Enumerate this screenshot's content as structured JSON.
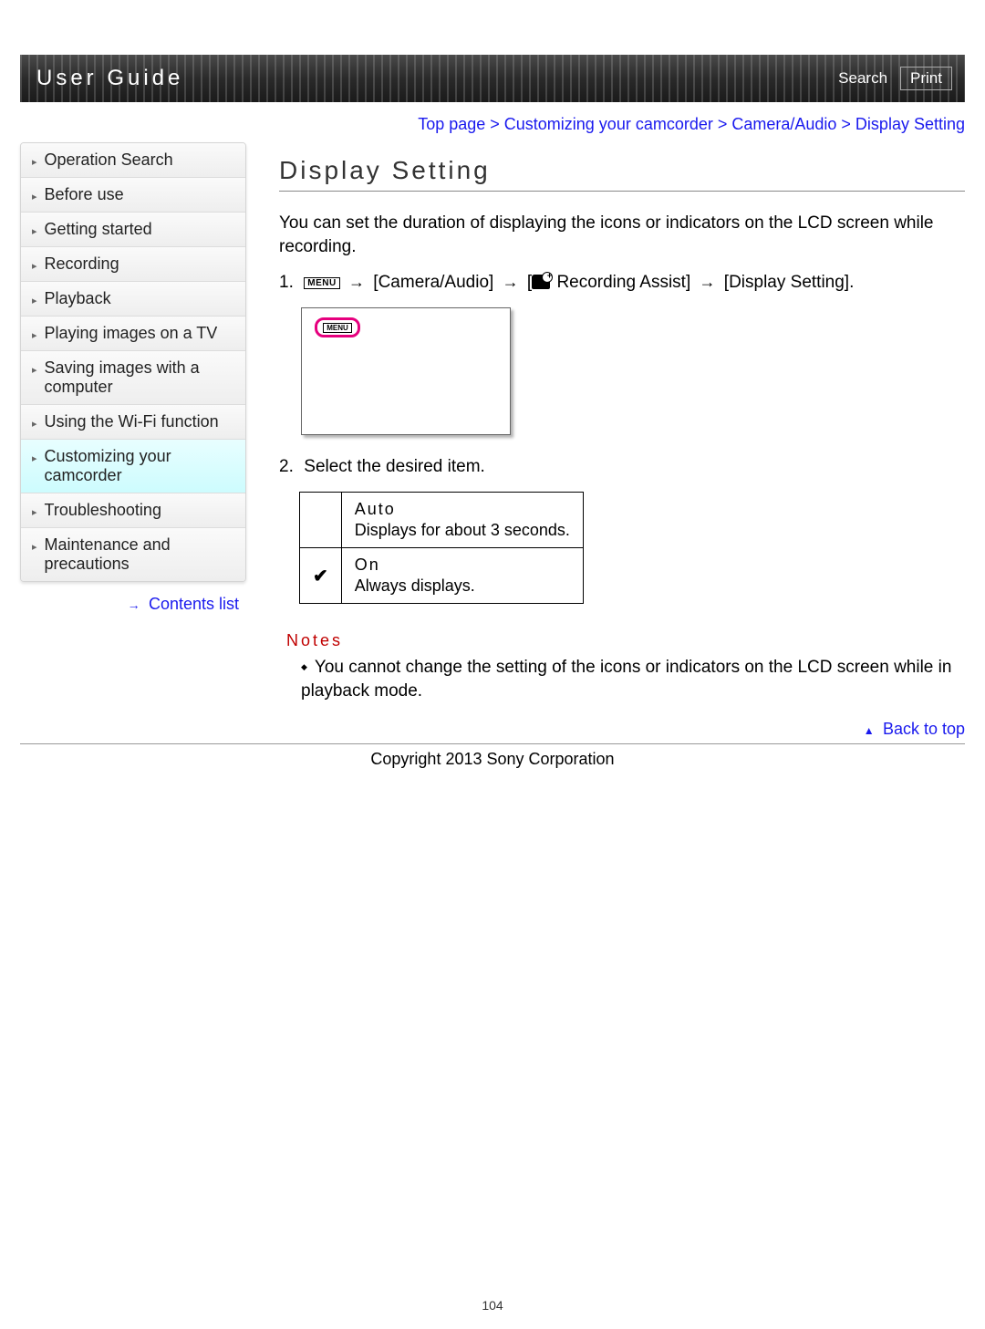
{
  "header": {
    "title": "User Guide",
    "search": "Search",
    "print": "Print"
  },
  "sidebar": {
    "items": [
      {
        "label": "Operation Search"
      },
      {
        "label": "Before use"
      },
      {
        "label": "Getting started"
      },
      {
        "label": "Recording"
      },
      {
        "label": "Playback"
      },
      {
        "label": "Playing images on a TV"
      },
      {
        "label": "Saving images with a computer"
      },
      {
        "label": "Using the Wi-Fi function"
      },
      {
        "label": "Customizing your camcorder"
      },
      {
        "label": "Troubleshooting"
      },
      {
        "label": "Maintenance and precautions"
      }
    ],
    "contents_link": "Contents list"
  },
  "breadcrumb": "Top page > Customizing your camcorder > Camera/Audio > Display Setting",
  "page_title": "Display Setting",
  "intro": "You can set the duration of displaying the icons or indicators on the LCD screen while recording.",
  "step1": {
    "num": "1.",
    "menu_badge": "MENU",
    "seg1": " [Camera/Audio] ",
    "seg2": "Recording Assist] ",
    "seg3": " [Display Setting].",
    "bracket_open": " ["
  },
  "screen_menu_inner": "MENU",
  "step2": {
    "num": "2.",
    "text": "Select the desired item."
  },
  "options": [
    {
      "check": "",
      "name": "Auto",
      "desc": "Displays for about 3 seconds."
    },
    {
      "check": "✔",
      "name": "On",
      "desc": "Always displays."
    }
  ],
  "notes": {
    "heading": "Notes",
    "items": [
      "You cannot change the setting of the icons or indicators on the LCD screen while in playback mode."
    ]
  },
  "back_to_top": "Back to top",
  "copyright": "Copyright 2013 Sony Corporation",
  "page_number": "104",
  "arrow": "→"
}
